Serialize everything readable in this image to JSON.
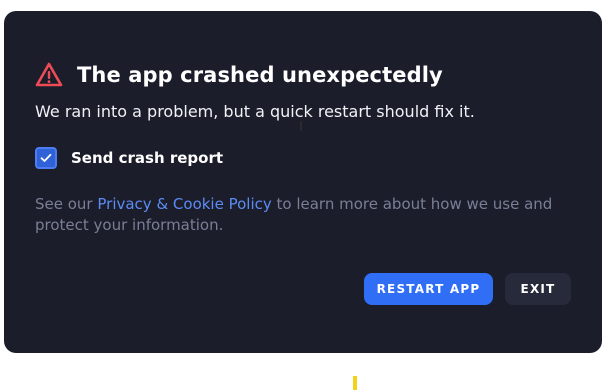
{
  "dialog": {
    "title": "The app crashed unexpectedly",
    "title_icon": "warning-triangle-icon",
    "subtitle": "We ran into a problem, but a quick restart should fix it.",
    "checkbox": {
      "label": "Send crash report",
      "checked": true
    },
    "info": {
      "prefix": "See our ",
      "link_text": "Privacy & Cookie Policy",
      "suffix": " to learn more about how we use and protect your information."
    },
    "buttons": {
      "restart_label": "RESTART APP",
      "exit_label": "EXIT"
    }
  },
  "colors": {
    "background": "#1b1d2b",
    "accent": "#2f6ef5",
    "warning": "#ef4b55",
    "link": "#5c8cf2"
  }
}
